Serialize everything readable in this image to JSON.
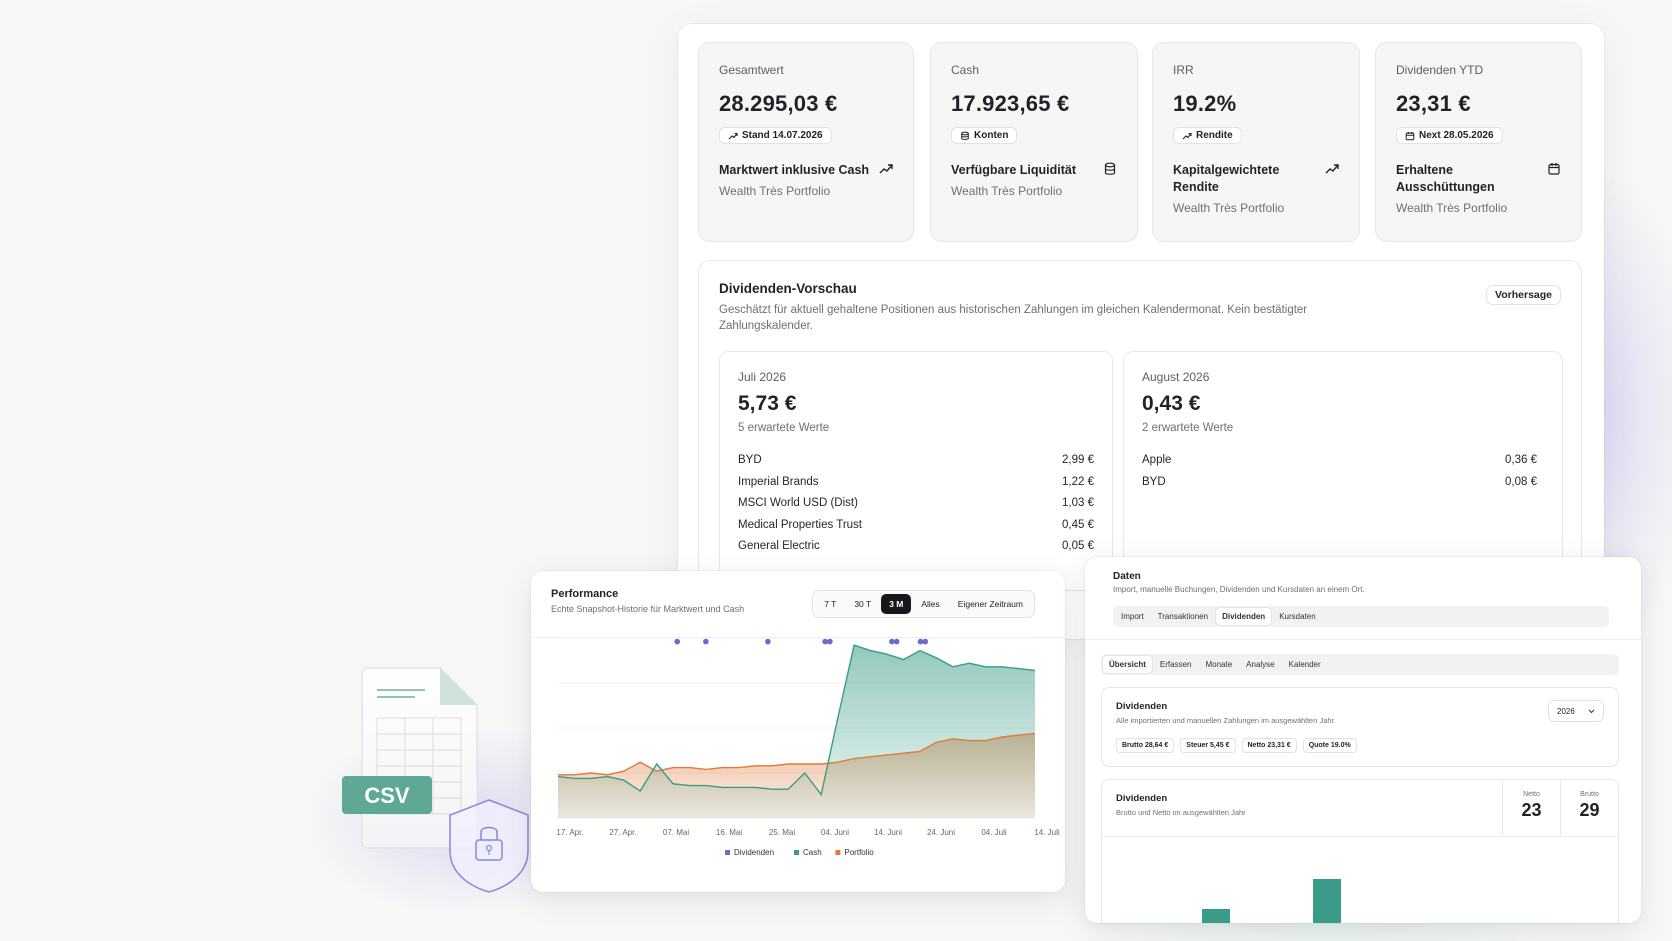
{
  "kpis": [
    {
      "label": "Gesamtwert",
      "value": "28.295,03 €",
      "badge": "Stand 14.07.2026",
      "badge_icon": "trend-up-icon",
      "desc": "Marktwert inklusive Cash",
      "desc_icon": "trend-up-icon",
      "sub": "Wealth Très Portfolio"
    },
    {
      "label": "Cash",
      "value": "17.923,65 €",
      "badge": "Konten",
      "badge_icon": "database-icon",
      "desc": "Verfügbare Liquidität",
      "desc_icon": "database-icon",
      "sub": "Wealth Très Portfolio"
    },
    {
      "label": "IRR",
      "value": "19.2%",
      "badge": "Rendite",
      "badge_icon": "trend-up-icon",
      "desc": "Kapitalgewichtete Rendite",
      "desc_icon": "trend-up-icon",
      "sub": "Wealth Très Portfolio"
    },
    {
      "label": "Dividenden YTD",
      "value": "23,31 €",
      "badge": "Next 28.05.2026",
      "badge_icon": "calendar-icon",
      "desc": "Erhaltene Ausschüttungen",
      "desc_icon": "calendar-icon",
      "sub": "Wealth Très Portfolio"
    }
  ],
  "dividend_preview": {
    "title": "Dividenden-Vorschau",
    "desc": "Geschätzt für aktuell gehaltene Positionen aus historischen Zahlungen im gleichen Kalendermonat. Kein bestätigter Zahlungskalender.",
    "badge": "Vorhersage",
    "months": [
      {
        "label": "Juli 2026",
        "value": "5,73 €",
        "sub": "5 erwartete Werte",
        "items": [
          {
            "name": "BYD",
            "amount": "2,99 €"
          },
          {
            "name": "Imperial Brands",
            "amount": "1,22 €"
          },
          {
            "name": "MSCI World USD (Dist)",
            "amount": "1,03 €"
          },
          {
            "name": "Medical Properties Trust",
            "amount": "0,45 €"
          },
          {
            "name": "General Electric",
            "amount": "0,05 €"
          }
        ]
      },
      {
        "label": "August 2026",
        "value": "0,43 €",
        "sub": "2 erwartete Werte",
        "items": [
          {
            "name": "Apple",
            "amount": "0,36 €"
          },
          {
            "name": "BYD",
            "amount": "0,08 €"
          }
        ]
      }
    ]
  },
  "performance": {
    "title": "Performance",
    "subtitle": "Echte Snapshot-Historie für Marktwert und Cash",
    "ranges": [
      "7 T",
      "30 T",
      "3 M",
      "Alles",
      "Eigener Zeitraum"
    ],
    "active_range": "3 M"
  },
  "chart_data": {
    "type": "area",
    "x_ticks": [
      "17. Apr.",
      "27. Apr.",
      "07. Mai",
      "16. Mai",
      "25. Mai",
      "04. Juni",
      "14. Juni",
      "24. Juni",
      "04. Juli",
      "14. Juli"
    ],
    "legend": [
      "Dividenden",
      "Cash",
      "Portfolio"
    ],
    "colors": {
      "Dividenden": "#6b6bc8",
      "Cash": "#3a9c88",
      "Portfolio": "#e07b3a"
    },
    "series": [
      {
        "name": "Cash",
        "values": [
          0.23,
          0.22,
          0.22,
          0.23,
          0.21,
          0.15,
          0.3,
          0.19,
          0.18,
          0.18,
          0.17,
          0.17,
          0.17,
          0.16,
          0.16,
          0.25,
          0.13,
          0.55,
          0.96,
          0.93,
          0.91,
          0.88,
          0.93,
          0.89,
          0.84,
          0.86,
          0.84,
          0.84,
          0.83,
          0.82
        ]
      },
      {
        "name": "Portfolio",
        "values": [
          0.24,
          0.24,
          0.25,
          0.24,
          0.26,
          0.31,
          0.26,
          0.28,
          0.28,
          0.27,
          0.28,
          0.28,
          0.29,
          0.29,
          0.3,
          0.3,
          0.3,
          0.31,
          0.33,
          0.34,
          0.35,
          0.36,
          0.37,
          0.42,
          0.44,
          0.43,
          0.43,
          0.45,
          0.46,
          0.47
        ]
      },
      {
        "name": "Dividenden",
        "x_positions": [
          0.25,
          0.31,
          0.44,
          0.56,
          0.57,
          0.7,
          0.71,
          0.76,
          0.77
        ]
      }
    ],
    "y_range": [
      0,
      1
    ]
  },
  "data_panel": {
    "title": "Daten",
    "subtitle": "Import, manuelle Buchungen, Dividenden und Kursdaten an einem Ort.",
    "tabs": [
      "Import",
      "Transaktionen",
      "Dividenden",
      "Kursdaten"
    ],
    "active_tab": "Dividenden",
    "subtabs": [
      "Übersicht",
      "Erfassen",
      "Monate",
      "Analyse",
      "Kalender"
    ],
    "active_subtab": "Übersicht",
    "card1": {
      "title": "Dividenden",
      "subtitle": "Alle importierten und manuellen Zahlungen im ausgewählten Jahr.",
      "year": "2026",
      "chips": [
        "Brutto 28,64 €",
        "Steuer 5,45 €",
        "Netto 23,31 €",
        "Quote 19.0%"
      ]
    },
    "card2": {
      "title": "Dividenden",
      "subtitle": "Brutto und Netto im ausgewählten Jahr",
      "metrics": [
        {
          "label": "Netto",
          "value": "23"
        },
        {
          "label": "Brutto",
          "value": "29"
        }
      ],
      "bars": [
        0.45,
        0.92
      ]
    }
  },
  "illustration": {
    "file_label": "CSV"
  }
}
